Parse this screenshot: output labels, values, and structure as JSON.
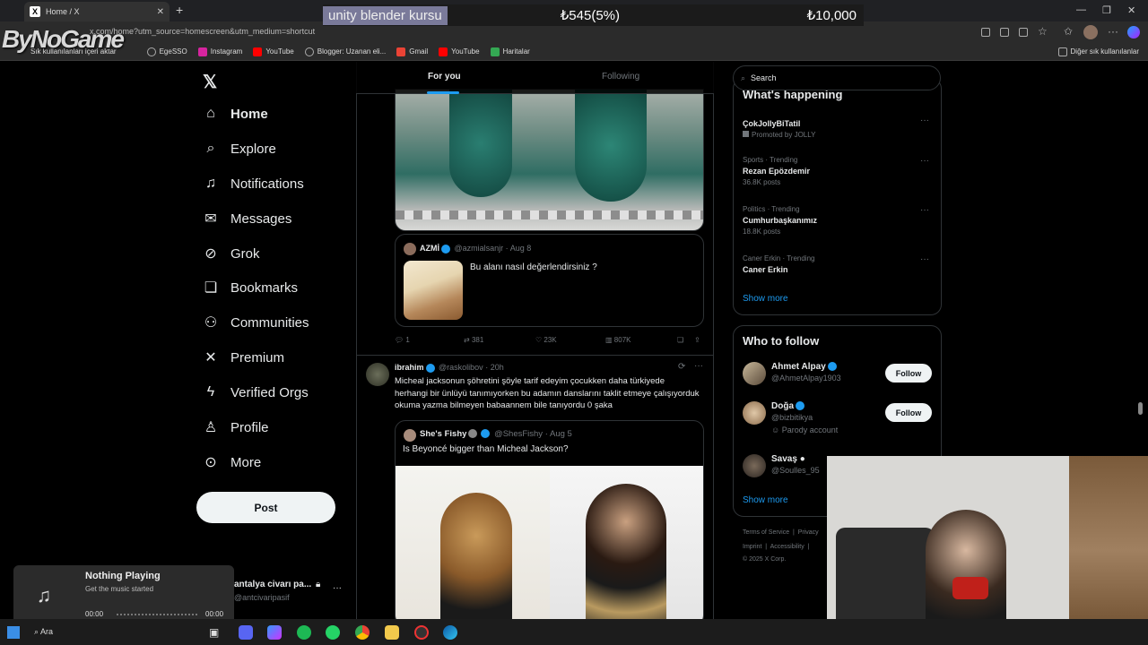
{
  "browser": {
    "tab_title": "Home / X",
    "url": "x.com/home?utm_source=homescreen&utm_medium=shortcut",
    "bookmarks": [
      "Sık kullanılanları içeri aktar",
      "EgeSSO",
      "Instagram",
      "YouTube",
      "Blogger: Uzanan eli...",
      "Gmail",
      "YouTube",
      "Haritalar"
    ],
    "other_bookmarks": "Diğer sık kullanılanlar",
    "watermark": "ByNoGame",
    "colors": {
      "instagram": "#d6249f",
      "youtube": "#ff0000",
      "gmail": "#ea4335",
      "maps": "#34a853"
    }
  },
  "promo": {
    "query": "unity blender kursu",
    "progress": "₺545(5%)",
    "goal": "₺10,000",
    "progress_fraction": 0.05
  },
  "sidebar": {
    "items": [
      {
        "label": "Home",
        "icon": "home-icon"
      },
      {
        "label": "Explore",
        "icon": "search-icon"
      },
      {
        "label": "Notifications",
        "icon": "bell-icon"
      },
      {
        "label": "Messages",
        "icon": "mail-icon"
      },
      {
        "label": "Grok",
        "icon": "grok-icon"
      },
      {
        "label": "Bookmarks",
        "icon": "bookmark-icon"
      },
      {
        "label": "Communities",
        "icon": "people-icon"
      },
      {
        "label": "Premium",
        "icon": "x-icon"
      },
      {
        "label": "Verified Orgs",
        "icon": "lightning-icon"
      },
      {
        "label": "Profile",
        "icon": "person-icon"
      },
      {
        "label": "More",
        "icon": "more-circle-icon"
      }
    ],
    "post_label": "Post",
    "account": {
      "name": "antalya civarı pa...",
      "handle": "@antcivaripasif"
    }
  },
  "feed": {
    "tabs": [
      "For you",
      "Following"
    ],
    "post1": {
      "quote_author": "AZMİ",
      "quote_handle": "@azmialsanjr",
      "quote_time": "Aug 8",
      "quote_text": "Bu alanı nasıl değerlendirsiniz ?",
      "replies": "1",
      "reposts": "381",
      "likes": "23K",
      "views": "807K"
    },
    "post2": {
      "author": "ibrahim",
      "handle": "@raskolibov",
      "time": "20h",
      "text": "Micheal jacksonun şöhretini şöyle tarif edeyim çocukken daha türkiyede herhangi bir ünlüyü tanımıyorken bu adamın danslarını taklit etmeye çalışıyorduk okuma yazma bilmeyen babaannem bile tanıyordu 0 şaka",
      "quote_author": "She's Fishy",
      "quote_handle": "@ShesFishy",
      "quote_time": "Aug 5",
      "quote_text": "Is Beyoncé bigger than Micheal Jackson?"
    }
  },
  "right": {
    "search_placeholder": "Search",
    "happening_title": "What's happening",
    "trends": [
      {
        "meta": "",
        "name": "ÇokJollyBiTatil",
        "count": "Promoted by JOLLY"
      },
      {
        "meta": "Sports · Trending",
        "name": "Rezan Epözdemir",
        "count": "36.8K posts"
      },
      {
        "meta": "Politics · Trending",
        "name": "Cumhurbaşkanımız",
        "count": "18.8K posts"
      },
      {
        "meta": "Caner Erkin · Trending",
        "name": "Caner Erkin",
        "count": ""
      }
    ],
    "show_more": "Show more",
    "who_title": "Who to follow",
    "who": [
      {
        "name": "Ahmet Alpay",
        "handle": "@AhmetAlpay1903",
        "extra": ""
      },
      {
        "name": "Doğa",
        "handle": "@bizbitikya",
        "extra": "Parody account"
      },
      {
        "name": "Savaş",
        "handle": "@Soulles_95",
        "extra": ""
      }
    ],
    "follow_label": "Follow",
    "show_more2": "Show more",
    "footer1": "Terms of Service  |  Privacy",
    "footer2": "Imprint  |  Accessibility  |",
    "footer3": "© 2025 X Corp."
  },
  "music": {
    "title": "Nothing Playing",
    "subtitle": "Get the music started",
    "time_start": "00:00",
    "time_end": "00:00"
  },
  "taskbar": {
    "search": "Ara"
  }
}
